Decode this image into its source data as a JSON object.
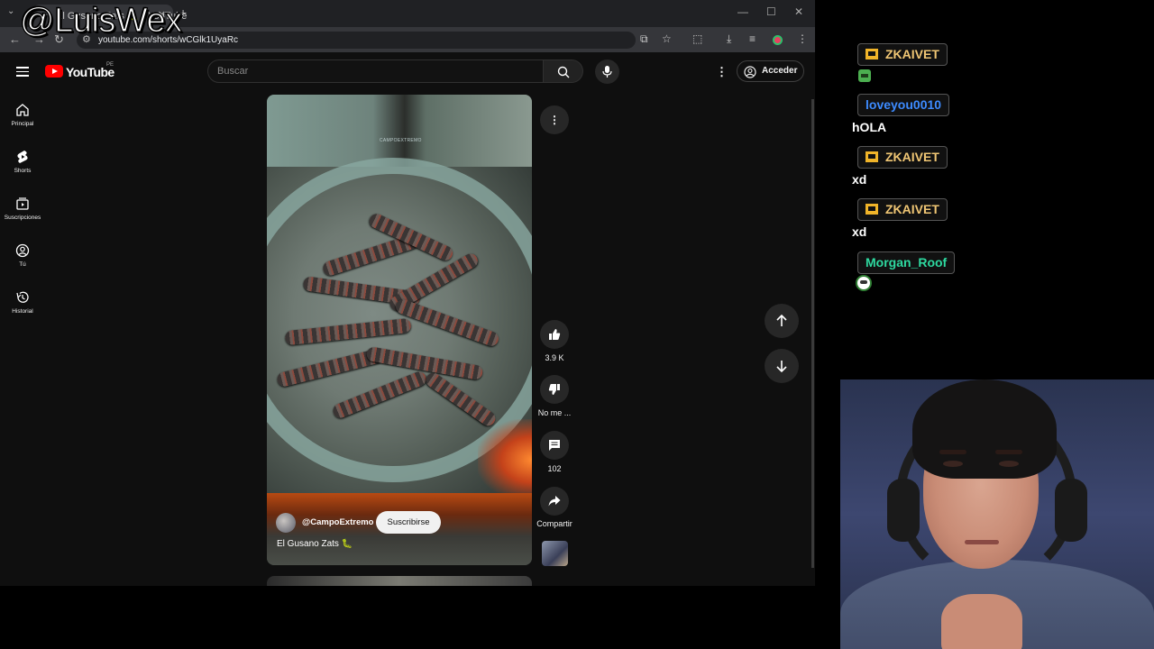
{
  "browser": {
    "tab_title": "El Gusano Zats 🐛 - YouTube",
    "url": "youtube.com/shorts/wCGlk1UyaRc",
    "window_controls": [
      "—",
      "☐",
      "✕"
    ]
  },
  "overlay": {
    "streamer_handle": "@LuisWex"
  },
  "youtube": {
    "logo_text": "YouTube",
    "country_code": "PE",
    "search_placeholder": "Buscar",
    "login_label": "Acceder",
    "sidebar": [
      {
        "label": "Principal",
        "icon": "home-icon"
      },
      {
        "label": "Shorts",
        "icon": "shorts-icon"
      },
      {
        "label": "Suscripciones",
        "icon": "subscriptions-icon"
      },
      {
        "label": "Tú",
        "icon": "you-icon"
      },
      {
        "label": "Historial",
        "icon": "history-icon"
      }
    ],
    "short": {
      "watermark": "CAMPOEXTREMO",
      "channel": "@CampoExtremo",
      "subscribe_label": "Suscribirse",
      "title": "El Gusano Zats 🐛",
      "like_count": "3.9 K",
      "dislike_label": "No me ...",
      "comment_count": "102",
      "share_label": "Compartir"
    }
  },
  "chat": [
    {
      "user": "ZKAIVET",
      "color": "#f0c674",
      "crown": true,
      "message": "",
      "emote": "green-emote"
    },
    {
      "user": "loveyou0010",
      "color": "#3d8bff",
      "crown": false,
      "message": "hOLA"
    },
    {
      "user": "ZKAIVET",
      "color": "#f0c674",
      "crown": true,
      "message": "xd"
    },
    {
      "user": "ZKAIVET",
      "color": "#f0c674",
      "crown": true,
      "message": "xd"
    },
    {
      "user": "Morgan_Roof",
      "color": "#2ed9a0",
      "crown": false,
      "message": "",
      "emote": "face-emote"
    }
  ],
  "colors": {
    "yt_red": "#ff0000",
    "yt_bg": "#0f0f0f",
    "chip_bg": "#272727"
  }
}
